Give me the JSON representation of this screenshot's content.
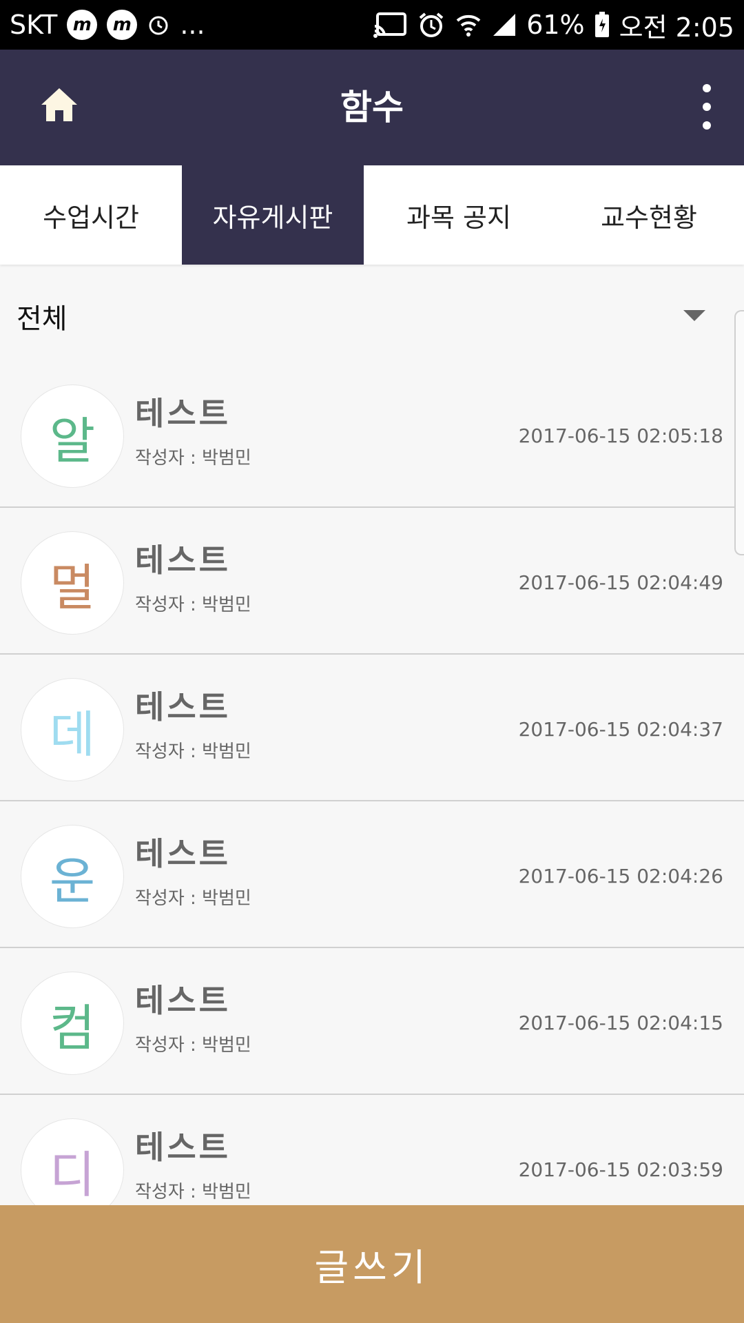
{
  "status_bar": {
    "carrier": "SKT",
    "dots": "...",
    "battery": "61%",
    "time": "오전 2:05",
    "icons": [
      "m-app-icon",
      "m-app-icon",
      "alarm-icon",
      "cast-icon",
      "alarm-clock-icon",
      "wifi-icon",
      "signal-icon",
      "battery-icon"
    ]
  },
  "app_bar": {
    "title": "함수",
    "home_icon": "home-icon",
    "more_icon": "more-vert-icon"
  },
  "tabs": [
    {
      "label": "수업시간",
      "active": false
    },
    {
      "label": "자유게시판",
      "active": true
    },
    {
      "label": "과목 공지",
      "active": false
    },
    {
      "label": "교수현황",
      "active": false
    }
  ],
  "filter": {
    "selected": "전체",
    "icon": "dropdown-arrow-icon"
  },
  "posts": [
    {
      "avatar_char": "알",
      "avatar_color": "#5cb88a",
      "title": "테스트",
      "author": "작성자 : 박범민",
      "date": "2017-06-15 02:05:18"
    },
    {
      "avatar_char": "멀",
      "avatar_color": "#c98a62",
      "title": "테스트",
      "author": "작성자 : 박범민",
      "date": "2017-06-15 02:04:49"
    },
    {
      "avatar_char": "데",
      "avatar_color": "#9fdcf0",
      "title": "테스트",
      "author": "작성자 : 박범민",
      "date": "2017-06-15 02:04:37"
    },
    {
      "avatar_char": "운",
      "avatar_color": "#6bb2d4",
      "title": "테스트",
      "author": "작성자 : 박범민",
      "date": "2017-06-15 02:04:26"
    },
    {
      "avatar_char": "컴",
      "avatar_color": "#5cb88a",
      "title": "테스트",
      "author": "작성자 : 박범민",
      "date": "2017-06-15 02:04:15"
    },
    {
      "avatar_char": "디",
      "avatar_color": "#c6a3d4",
      "title": "테스트",
      "author": "작성자 : 박범민",
      "date": "2017-06-15 02:03:59"
    }
  ],
  "write_button": {
    "label": "글쓰기"
  },
  "colors": {
    "app_bar": "#34314d",
    "active_tab": "#34314d",
    "write_button": "#c79b62"
  }
}
